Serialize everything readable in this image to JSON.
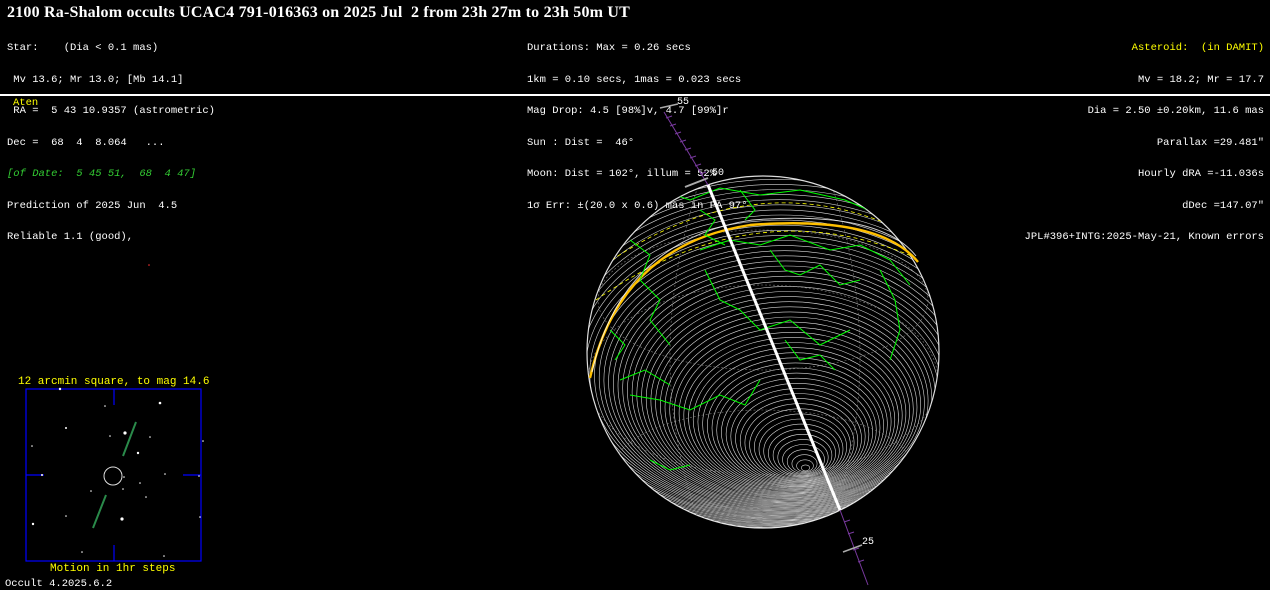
{
  "header": {
    "title": "2100 Ra-Shalom occults UCAC4 791-016363 on 2025 Jul  2 from 23h 27m to 23h 50m UT"
  },
  "star_info": {
    "line1": "Star:    (Dia < 0.1 mas)",
    "line2": " Mv 13.6; Mr 13.0; [Mb 14.1]",
    "line3": " RA =  5 43 10.9357 (astrometric)",
    "line4": "Dec =  68  4  8.064   ...",
    "line5": "[of Date:  5 45 51,  68  4 47]",
    "line6": "Prediction of 2025 Jun  4.5",
    "line7": "Reliable 1.1 (good),"
  },
  "event_info": {
    "line1": "Durations: Max = 0.26 secs",
    "line2": "1km = 0.10 secs, 1mas = 0.023 secs",
    "line3": "Mag Drop: 4.5 [98%]v, 4.7 [99%]r",
    "line4": "Sun : Dist =  46°",
    "line5": "Moon: Dist = 102°, illum = 52%",
    "line6": "1σ Err: ±(20.0 x 0.6) mas in PA 97°"
  },
  "asteroid_info": {
    "line1": "Asteroid:  (in DAMIT)",
    "line2": "Mv = 18.2; Mr = 17.7",
    "line3": "Dia = 2.50 ±0.20km, 11.6 mas",
    "line4": "Parallax =29.481\"",
    "line5": "Hourly dRA =-11.036s",
    "line6": "dDec =147.07\"",
    "line7": "JPL#396+INTG:2025-May-21, Known errors"
  },
  "class_label": "Aten",
  "track_labels": {
    "t55": "55",
    "t50": "50",
    "t25": "25"
  },
  "starchart": {
    "title": "12 arcmin square, to mag 14.6",
    "motion": "Motion in 1hr steps"
  },
  "version": "Occult 4.2025.6.2",
  "colors": {
    "background": "#000000",
    "text": "#ffffff",
    "highlight": "#ffff00",
    "coastline": "#00ff00",
    "track": "#ffffff",
    "twilight": "#ffc000",
    "chart_border": "#0000ff"
  }
}
